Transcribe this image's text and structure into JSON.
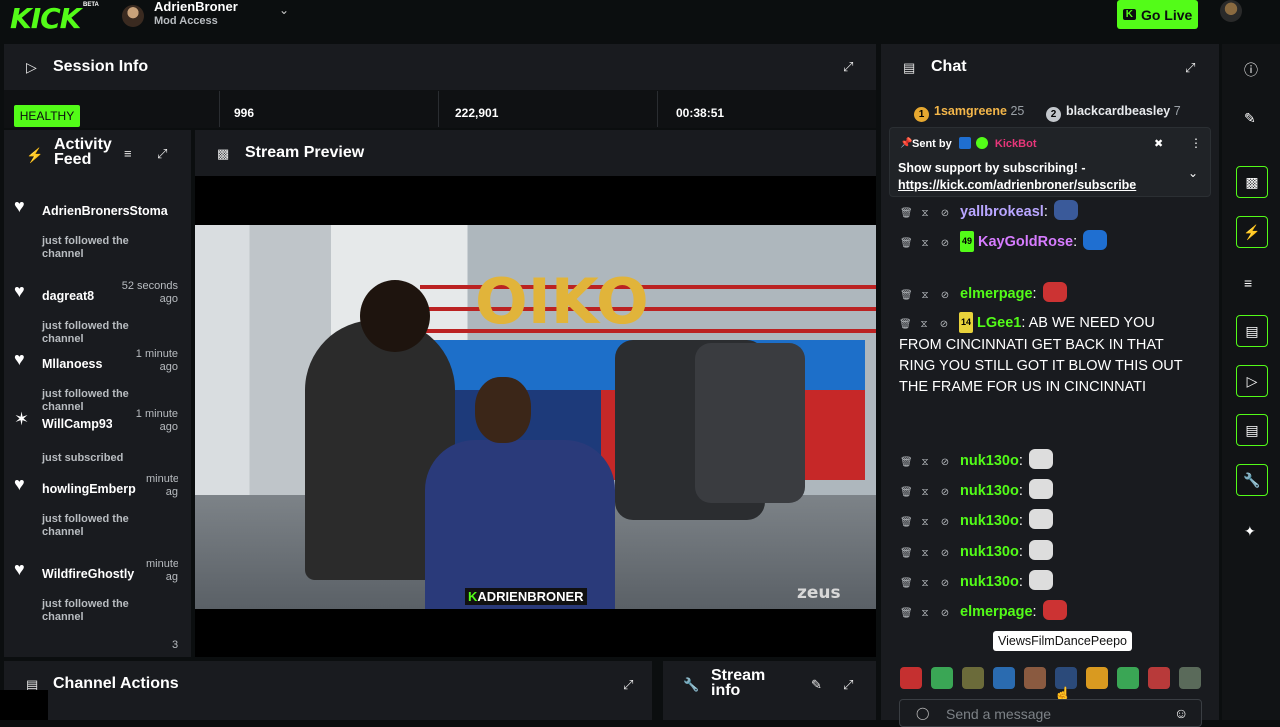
{
  "topbar": {
    "logo": "KICK",
    "beta": "BETA",
    "user_name": "AdrienBroner",
    "user_role": "Mod Access",
    "go_live": "Go Live"
  },
  "session": {
    "title": "Session Info",
    "health": "HEALTHY",
    "viewers": "996",
    "followers": "222,901",
    "uptime": "00:38:51"
  },
  "activity": {
    "title_line1": "Activity",
    "title_line2": "Feed",
    "items": [
      {
        "icon": "heart-icon",
        "name": "AdrienBronersStoma",
        "time": "",
        "desc": "just followed the channel"
      },
      {
        "icon": "heart-icon",
        "name": "dagreat8",
        "time": "52 seconds ago",
        "desc": "just followed the channel"
      },
      {
        "icon": "heart-icon",
        "name": "Mllanoess",
        "time": "1 minute ago",
        "desc": "just followed the channel"
      },
      {
        "icon": "star-icon",
        "name": "WillCamp93",
        "time": "1 minute ago",
        "desc": "just subscribed"
      },
      {
        "icon": "heart-icon",
        "name": "howlingEmberp",
        "time": "minute ag",
        "desc": "just followed the channel"
      },
      {
        "icon": "heart-icon",
        "name": "WildfireGhostly",
        "time": "minute ag",
        "desc": "just followed the channel"
      }
    ],
    "bottom_count": "3"
  },
  "preview": {
    "title": "Stream Preview",
    "balloon_text": "OIKO",
    "watermark": "ADRIENBRONER",
    "watermark_k": "K",
    "brand": "zeus"
  },
  "channel_actions": {
    "title": "Channel Actions"
  },
  "stream_info": {
    "title_line1": "Stream",
    "title_line2": "info"
  },
  "chat": {
    "title": "Chat",
    "leaders": [
      {
        "rank": "1",
        "name": "1samgreene",
        "count": "25"
      },
      {
        "rank": "2",
        "name": "blackcardbeasley",
        "count": "7"
      }
    ],
    "pinned": {
      "sent_by": "Sent by",
      "bot": "KickBot",
      "message": "Show support by subscribing! -",
      "link": "https://kick.com/adrienbroner/subscribe"
    },
    "messages": [
      {
        "user": "yallbrokeasl",
        "color": "#b9a6ff",
        "text": ""
      },
      {
        "user": "KayGoldRose",
        "color": "#d77cff",
        "badge": "49",
        "text": ""
      },
      {
        "user": "elmerpage",
        "color": "#53fc18",
        "text": ""
      },
      {
        "user": "LGee1",
        "color": "#53fc18",
        "badge": "14",
        "text": "AB WE NEED YOU FROM CINCINNATI GET BACK IN THAT RING YOU STILL GOT IT BLOW THIS OUT THE FRAME FOR US IN CINCINNATI"
      },
      {
        "user": "nuk130o",
        "color": "#53fc18",
        "text": ""
      },
      {
        "user": "nuk130o",
        "color": "#53fc18",
        "text": ""
      },
      {
        "user": "nuk130o",
        "color": "#53fc18",
        "text": ""
      },
      {
        "user": "nuk130o",
        "color": "#53fc18",
        "text": ""
      },
      {
        "user": "nuk130o",
        "color": "#53fc18",
        "text": ""
      },
      {
        "user": "elmerpage",
        "color": "#53fc18",
        "text": ""
      }
    ],
    "tooltip": "ViewsFilmDancePeepo",
    "send_placeholder": "Send a message"
  },
  "colors": {
    "accent": "#53fc18",
    "panel": "#191b1f",
    "bg": "#0b0e0f"
  }
}
